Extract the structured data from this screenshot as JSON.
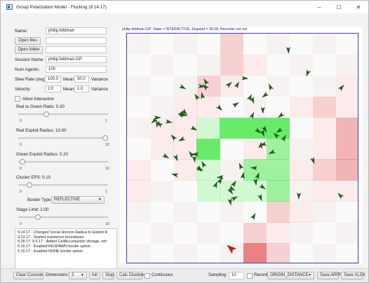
{
  "window": {
    "title": "Group Polarization Model - Flocking (9.14.17)",
    "minimize": "–",
    "maximize": "☐",
    "close": "✕"
  },
  "form": {
    "name_label": "Name:",
    "name_value": "philip.feldman",
    "open_files_label": "Open files",
    "open_folder_label": "Open folder",
    "session_label": "Session Name:",
    "session_value": "philip.feldman-GP",
    "num_agents_label": "Num Agents:",
    "num_agents_value": "100",
    "slew_label": "Slew Rate (deg):",
    "slew_value": "100.0",
    "slew_mean_label": "Mean",
    "slew_mean_value": "50.0",
    "slew_variance_label": "Variance",
    "velocity_label": "Velocity:",
    "velocity_value": "2.0",
    "velocity_mean_label": "Mean",
    "velocity_mean_value": "1.0",
    "velocity_variance_label": "Variance",
    "allow_interaction_label": "Allow Interaction"
  },
  "sliders": [
    {
      "label": "Red to Green Ratio: 0.30",
      "min": "0",
      "max": "1",
      "fraction": 0.3
    },
    {
      "label": "Red Exploit Radius: 10.00",
      "min": "0",
      "max": "10",
      "fraction": 1.0
    },
    {
      "label": "Green Exploit Radius: 0.20",
      "min": "0",
      "max": "10",
      "fraction": 0.02
    },
    {
      "label": "Cluster EPS: 0.10",
      "min": "0",
      "max": "1",
      "fraction": 0.1
    }
  ],
  "border": {
    "label": "Border Type:",
    "value": "REFLECTIVE"
  },
  "stage": {
    "label": "Stage Limit: 2.00",
    "min": "0",
    "max": "10",
    "fraction": 0.2
  },
  "log": [
    "9.14.17 - Changed Social Horizon Radius to Exploit R",
    "9.13.17 - Started resistance boundaries",
    "8.28.17: 9.5.17 - Added CellAccumulator storage, retr",
    "6.16.17 - Enabled RESPAWN border option",
    "6.15.17 - Enabled NONE border option"
  ],
  "status_text": "philip.feldman-GP: State = INTERACTIVE, Elapsed = 35.58, Recorder not set",
  "heatmap": {
    "cols": 10,
    "rows": 10,
    "cells": [
      [
        0,
        0,
        0,
        0,
        -2,
        0,
        0,
        0,
        0,
        0
      ],
      [
        0,
        0,
        0,
        0,
        -2,
        -1,
        0,
        0,
        0,
        0
      ],
      [
        0,
        0,
        0,
        -2,
        -1,
        0,
        0,
        0,
        0,
        -1
      ],
      [
        0,
        0,
        -1,
        -1,
        0,
        0,
        0,
        -1,
        -2,
        -1
      ],
      [
        0,
        -1,
        -1,
        1,
        3,
        3,
        3,
        0,
        -1,
        -3
      ],
      [
        0,
        -1,
        -1,
        3,
        0,
        -1,
        2,
        0,
        -1,
        -3
      ],
      [
        -1,
        0,
        -1,
        1,
        0,
        2,
        2,
        -1,
        -2,
        -3
      ],
      [
        -1,
        0,
        0,
        1,
        1,
        1,
        2,
        0,
        -1,
        -1
      ],
      [
        0,
        0,
        0,
        0,
        0,
        0,
        -2,
        -1,
        0,
        0
      ],
      [
        0,
        0,
        0,
        0,
        0,
        -2,
        -1,
        0,
        0,
        0
      ],
      [
        0,
        0,
        0,
        0,
        0,
        -4,
        -2,
        0,
        0,
        0
      ]
    ],
    "green_color": "#7df07d",
    "red_color": "#f07070"
  },
  "agents": {
    "count_shown": 70,
    "color": "#1e5c1e",
    "red_agent_color": "#c21b1b"
  },
  "bottom": {
    "clear_console": "Clear Console",
    "dimensions_label": "Dimensions:",
    "dimensions_value": "2",
    "init": "Init",
    "stop": "Stop",
    "calc_clusters": "Calc Clusters",
    "continuous": "Continuous",
    "sampling_label": "Sampling:",
    "sampling_value": "10",
    "record": "Record",
    "record_value": "ORIGIN_DISTANCE",
    "save_arff": "Save ARFF",
    "save_xlsx": "Save XLSX"
  }
}
